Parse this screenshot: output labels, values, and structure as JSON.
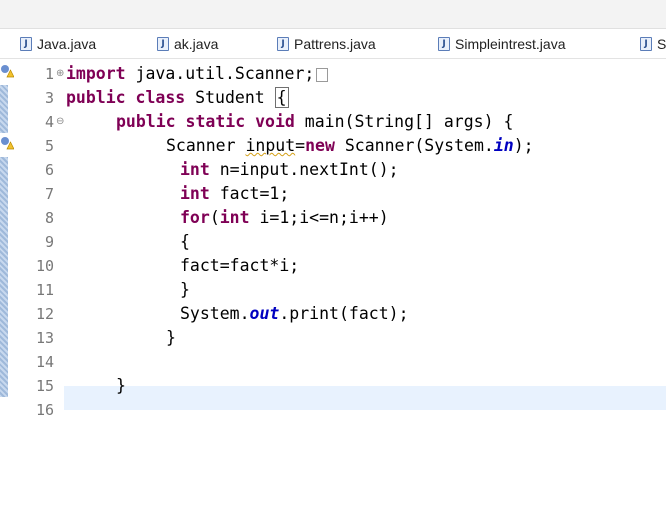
{
  "tabs": [
    {
      "label": "Java.java"
    },
    {
      "label": "ak.java"
    },
    {
      "label": "Pattrens.java"
    },
    {
      "label": "Simpleintrest.java"
    },
    {
      "label": "S"
    }
  ],
  "icons": {
    "tab_file": "java-file-icon",
    "warning": "warning-icon",
    "fold": "fold-toggle-icon"
  },
  "editor": {
    "line_numbers": [
      "1",
      "3",
      "4",
      "5",
      "6",
      "7",
      "8",
      "9",
      "10",
      "11",
      "12",
      "13",
      "14",
      "15",
      "16"
    ],
    "current_line": "15",
    "code": {
      "l1_kw": "import",
      "l1_rest": " java.util.Scanner;",
      "l3_kw1": "public",
      "l3_kw2": "class",
      "l3_name": " Student ",
      "l3_brace": "{",
      "l4_kw1": "public",
      "l4_kw2": "static",
      "l4_kw3": "void",
      "l4_rest": " main(String[] args) {",
      "l5_a": "Scanner ",
      "l5_var": "input",
      "l5_b": "=",
      "l5_kw": "new",
      "l5_c": " Scanner(System.",
      "l5_field": "in",
      "l5_d": ");",
      "l6_kw": "int",
      "l6_rest": " n=input.nextInt();",
      "l7_kw": "int",
      "l7_rest": " fact=1;",
      "l8_kw1": "for",
      "l8_a": "(",
      "l8_kw2": "int",
      "l8_rest": " i=1;i<=n;i++)",
      "l9": "{",
      "l10": "fact=fact*i;",
      "l11": "}",
      "l12_a": "System.",
      "l12_field": "out",
      "l12_b": ".print(fact);",
      "l13": "}",
      "l15": "}"
    }
  }
}
